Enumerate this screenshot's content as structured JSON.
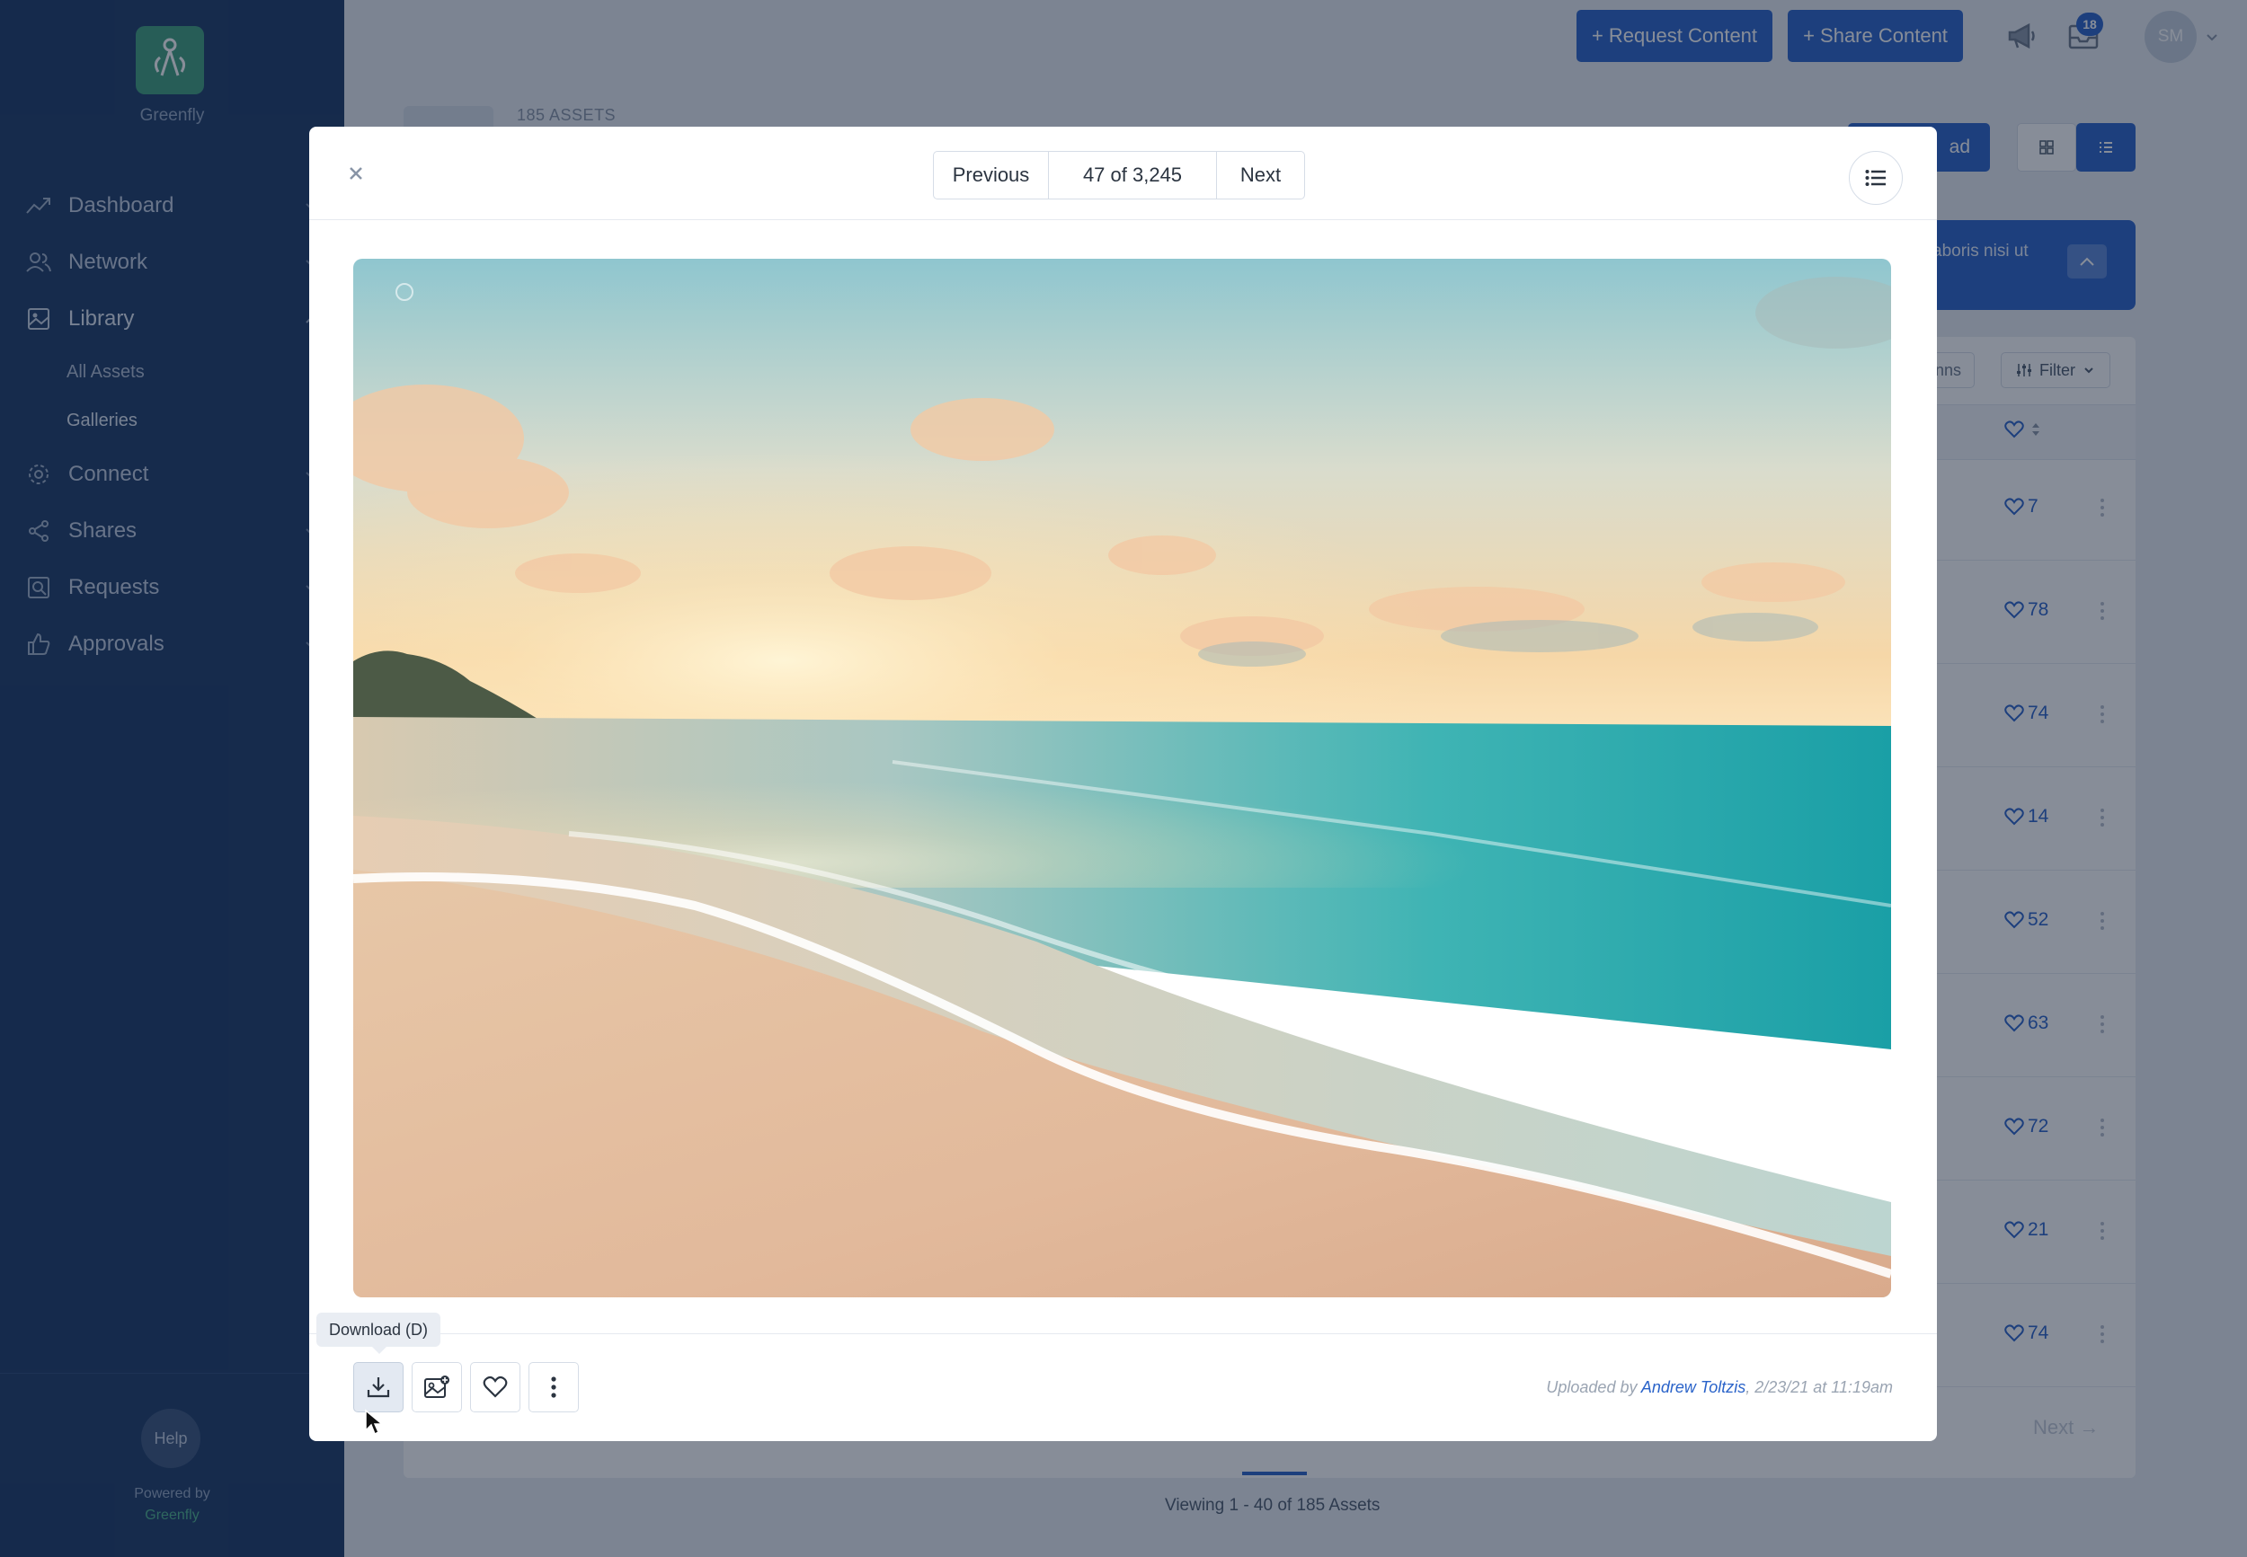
{
  "app": {
    "brand_name": "Greenfly"
  },
  "sidebar": {
    "items": [
      {
        "label": "Dashboard",
        "icon": "trend-icon"
      },
      {
        "label": "Network",
        "icon": "users-icon"
      },
      {
        "label": "Library",
        "icon": "image-icon",
        "expanded": true
      },
      {
        "label": "Connect",
        "icon": "gear-icon"
      },
      {
        "label": "Shares",
        "icon": "share-icon"
      },
      {
        "label": "Requests",
        "icon": "search-image-icon"
      },
      {
        "label": "Approvals",
        "icon": "thumbs-up-icon"
      }
    ],
    "library_sub": [
      "All Assets",
      "Galleries"
    ],
    "help_label": "Help",
    "powered_by": "Powered by",
    "powered_brand": "Greenfly"
  },
  "topbar": {
    "request_label": "+ Request Content",
    "share_label": "+ Share Content",
    "inbox_count": "18",
    "avatar_initials": "SM"
  },
  "library": {
    "assets_count": "185 ASSETS",
    "upload_label": "ad",
    "notice_text": "aboris nisi ut",
    "columns_label": "nns",
    "filter_label": "Filter",
    "likes": [
      "7",
      "78",
      "74",
      "14",
      "52",
      "63",
      "72",
      "21",
      "74"
    ],
    "next_label": "Next",
    "viewing_text": "Viewing 1 - 40 of 185 Assets"
  },
  "modal": {
    "prev_label": "Previous",
    "position": "47 of 3,245",
    "next_label": "Next",
    "tooltip": "Download (D)",
    "uploaded_prefix": "Uploaded by",
    "uploader": "Andrew Toltzis",
    "uploaded_suffix": ", 2/23/21 at 11:19am"
  },
  "colors": {
    "primary": "#2a63c9",
    "sidebar": "#1c3a67",
    "brand_green": "#3f9f7c"
  }
}
